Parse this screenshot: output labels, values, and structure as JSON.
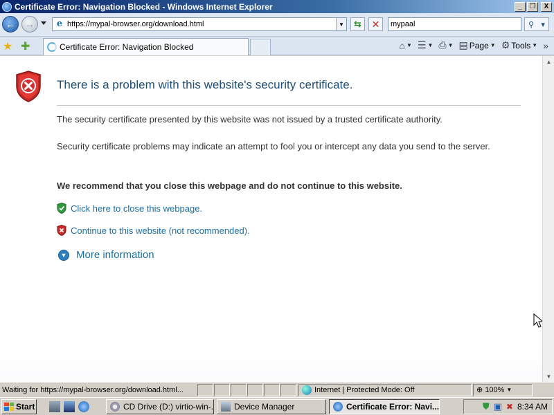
{
  "window": {
    "title": "Certificate Error: Navigation Blocked - Windows Internet Explorer",
    "minimize": "_",
    "restore": "❐",
    "close": "X"
  },
  "navbar": {
    "url": "https://mypal-browser.org/download.html",
    "search_value": "mypaal"
  },
  "tabs": [
    {
      "label": "Certificate Error: Navigation Blocked"
    }
  ],
  "commandbar": {
    "page_label": "Page",
    "tools_label": "Tools"
  },
  "page": {
    "heading": "There is a problem with this website's security certificate.",
    "paragraph1": "The security certificate presented by this website was not issued by a trusted certificate authority.",
    "paragraph2": "Security certificate problems may indicate an attempt to fool you or intercept any data you send to the server.",
    "recommendation": "We recommend that you close this webpage and do not continue to this website.",
    "close_link": "Click here to close this webpage.",
    "continue_link": "Continue to this website (not recommended).",
    "more_info": "More information"
  },
  "statusbar": {
    "text": "Waiting for https://mypal-browser.org/download.html...",
    "zone": "Internet | Protected Mode: Off",
    "zoom": "100%"
  },
  "taskbar": {
    "start_label": "Start",
    "buttons": [
      {
        "label": "CD Drive (D:) virtio-win-..."
      },
      {
        "label": "Device Manager"
      },
      {
        "label": "Certificate Error: Navi..."
      }
    ],
    "clock": "8:34 AM"
  },
  "colors": {
    "heading": "#1f4e79",
    "link": "#1a6fa8",
    "shield_red": "#c62828",
    "shield_green": "#2e9a3c"
  }
}
